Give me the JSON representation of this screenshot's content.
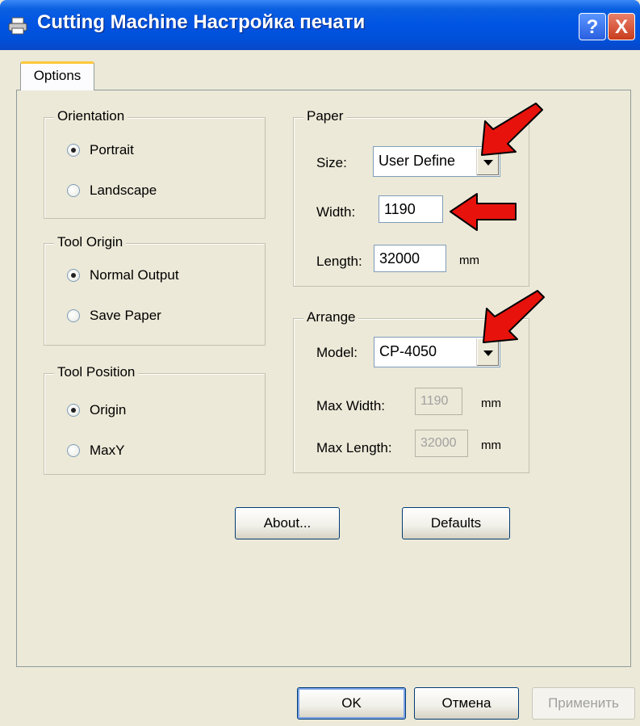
{
  "window": {
    "title": "Cutting Machine Настройка печати",
    "help_label": "?",
    "close_label": "X"
  },
  "tabs": [
    {
      "label": "Options",
      "selected": true
    }
  ],
  "orientation": {
    "legend": "Orientation",
    "options": [
      {
        "label": "Portrait",
        "checked": true
      },
      {
        "label": "Landscape",
        "checked": false
      }
    ]
  },
  "tool_origin": {
    "legend": "Tool Origin",
    "options": [
      {
        "label": "Normal Output",
        "checked": true
      },
      {
        "label": "Save Paper",
        "checked": false
      }
    ]
  },
  "tool_position": {
    "legend": "Tool Position",
    "options": [
      {
        "label": "Origin",
        "checked": true
      },
      {
        "label": "MaxY",
        "checked": false
      }
    ]
  },
  "paper": {
    "legend": "Paper",
    "size_label": "Size:",
    "size_value": "User Define",
    "width_label": "Width:",
    "width_value": "1190",
    "length_label": "Length:",
    "length_value": "32000",
    "unit": "mm"
  },
  "arrange": {
    "legend": "Arrange",
    "model_label": "Model:",
    "model_value": "CP-4050",
    "max_width_label": "Max Width:",
    "max_width_value": "1190",
    "max_width_unit": "mm",
    "max_length_label": "Max Length:",
    "max_length_value": "32000",
    "max_length_unit": "mm"
  },
  "buttons": {
    "about": "About...",
    "defaults": "Defaults",
    "ok": "OK",
    "cancel": "Отмена",
    "apply": "Применить"
  },
  "colors": {
    "titlebar": "#0054e3",
    "dialog_bg": "#ece9d8",
    "tab_highlight": "#ffc83c",
    "annotation_arrow": "#e8120c"
  }
}
